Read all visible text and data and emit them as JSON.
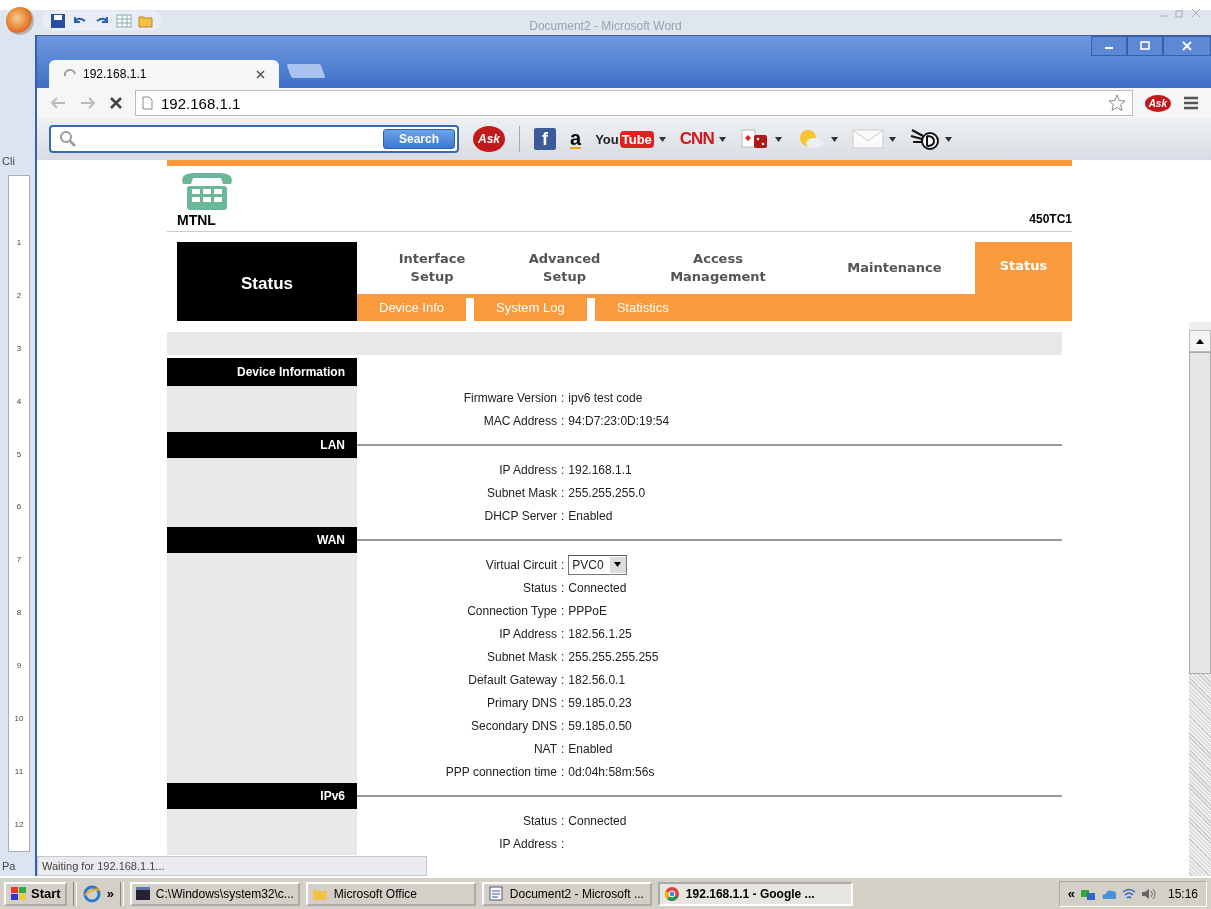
{
  "word_window": {
    "title": "Document2 - Microsoft Word",
    "ribbon_labels": [
      "Cli",
      "Pa"
    ],
    "ruler_numbers": [
      "1",
      "2",
      "3",
      "4",
      "5",
      "6",
      "7",
      "8",
      "9",
      "10",
      "11",
      "12"
    ]
  },
  "browser": {
    "tabs": [
      {
        "title": "192.168.1.1",
        "selected": true,
        "loading": true
      }
    ],
    "address": "192.168.1.1",
    "extension_label": "Ask",
    "status_text": "Waiting for 192.168.1.1..."
  },
  "toolbar": {
    "search_button": "Search",
    "items": [
      {
        "kind": "ask",
        "label": "Ask"
      },
      {
        "kind": "facebook",
        "label": "f"
      },
      {
        "kind": "amazon",
        "label": "a"
      },
      {
        "kind": "youtube",
        "label": "You",
        "label2": "Tube",
        "dropdown": true
      },
      {
        "kind": "cnn",
        "label": "CNN",
        "dropdown": true
      },
      {
        "kind": "games",
        "dropdown": true
      },
      {
        "kind": "weather",
        "dropdown": true
      },
      {
        "kind": "mail",
        "dropdown": true
      },
      {
        "kind": "dictionary",
        "dropdown": true
      }
    ]
  },
  "router": {
    "brand": "MTNL",
    "model": "450TC1",
    "section_title": "Status",
    "menu": [
      {
        "lines": [
          "Interface",
          "Setup"
        ],
        "selected": false
      },
      {
        "lines": [
          "Advanced",
          "Setup"
        ],
        "selected": false
      },
      {
        "lines": [
          "Access",
          "Management"
        ],
        "selected": false
      },
      {
        "lines": [
          "Maintenance"
        ],
        "selected": false
      },
      {
        "lines": [
          "Status"
        ],
        "selected": true
      }
    ],
    "submenu": [
      "Device Info",
      "System Log",
      "Statistics"
    ],
    "label_separator": ":",
    "sections": [
      {
        "title": "Device Information",
        "rows": [
          {
            "label": "Firmware Version",
            "value": "ipv6 test code"
          },
          {
            "label": "MAC Address",
            "value": "94:D7:23:0D:19:54"
          }
        ]
      },
      {
        "title": "LAN",
        "rows": [
          {
            "label": "IP Address",
            "value": "192.168.1.1"
          },
          {
            "label": "Subnet Mask",
            "value": "255.255.255.0"
          },
          {
            "label": "DHCP Server",
            "value": "Enabled"
          }
        ]
      },
      {
        "title": "WAN",
        "rows": [
          {
            "label": "Virtual Circuit",
            "value": "PVC0",
            "kind": "select"
          },
          {
            "label": "Status",
            "value": "Connected"
          },
          {
            "label": "Connection Type",
            "value": "PPPoE"
          },
          {
            "label": "IP Address",
            "value": "182.56.1.25"
          },
          {
            "label": "Subnet Mask",
            "value": "255.255.255.255"
          },
          {
            "label": "Default Gateway",
            "value": "182.56.0.1"
          },
          {
            "label": "Primary DNS",
            "value": "59.185.0.23"
          },
          {
            "label": "Secondary DNS",
            "value": "59.185.0.50"
          },
          {
            "label": "NAT",
            "value": "Enabled"
          },
          {
            "label": "PPP connection time",
            "value": "0d:04h:58m:56s"
          }
        ]
      },
      {
        "title": "IPv6",
        "rows": [
          {
            "label": "Status",
            "value": "Connected"
          },
          {
            "label": "IP Address"
          }
        ]
      }
    ]
  },
  "taskbar": {
    "start": "Start",
    "chevron": "»",
    "tasks": [
      {
        "kind": "console",
        "label": "C:\\Windows\\system32\\c...",
        "selected": false
      },
      {
        "kind": "folder",
        "label": "Microsoft Office",
        "selected": false
      },
      {
        "kind": "word",
        "label": "Document2 - Microsoft ...",
        "selected": false
      },
      {
        "kind": "chrome",
        "label": "192.168.1.1 - Google ...",
        "selected": true
      }
    ],
    "tray_chevron": "«",
    "clock": "15:16"
  }
}
